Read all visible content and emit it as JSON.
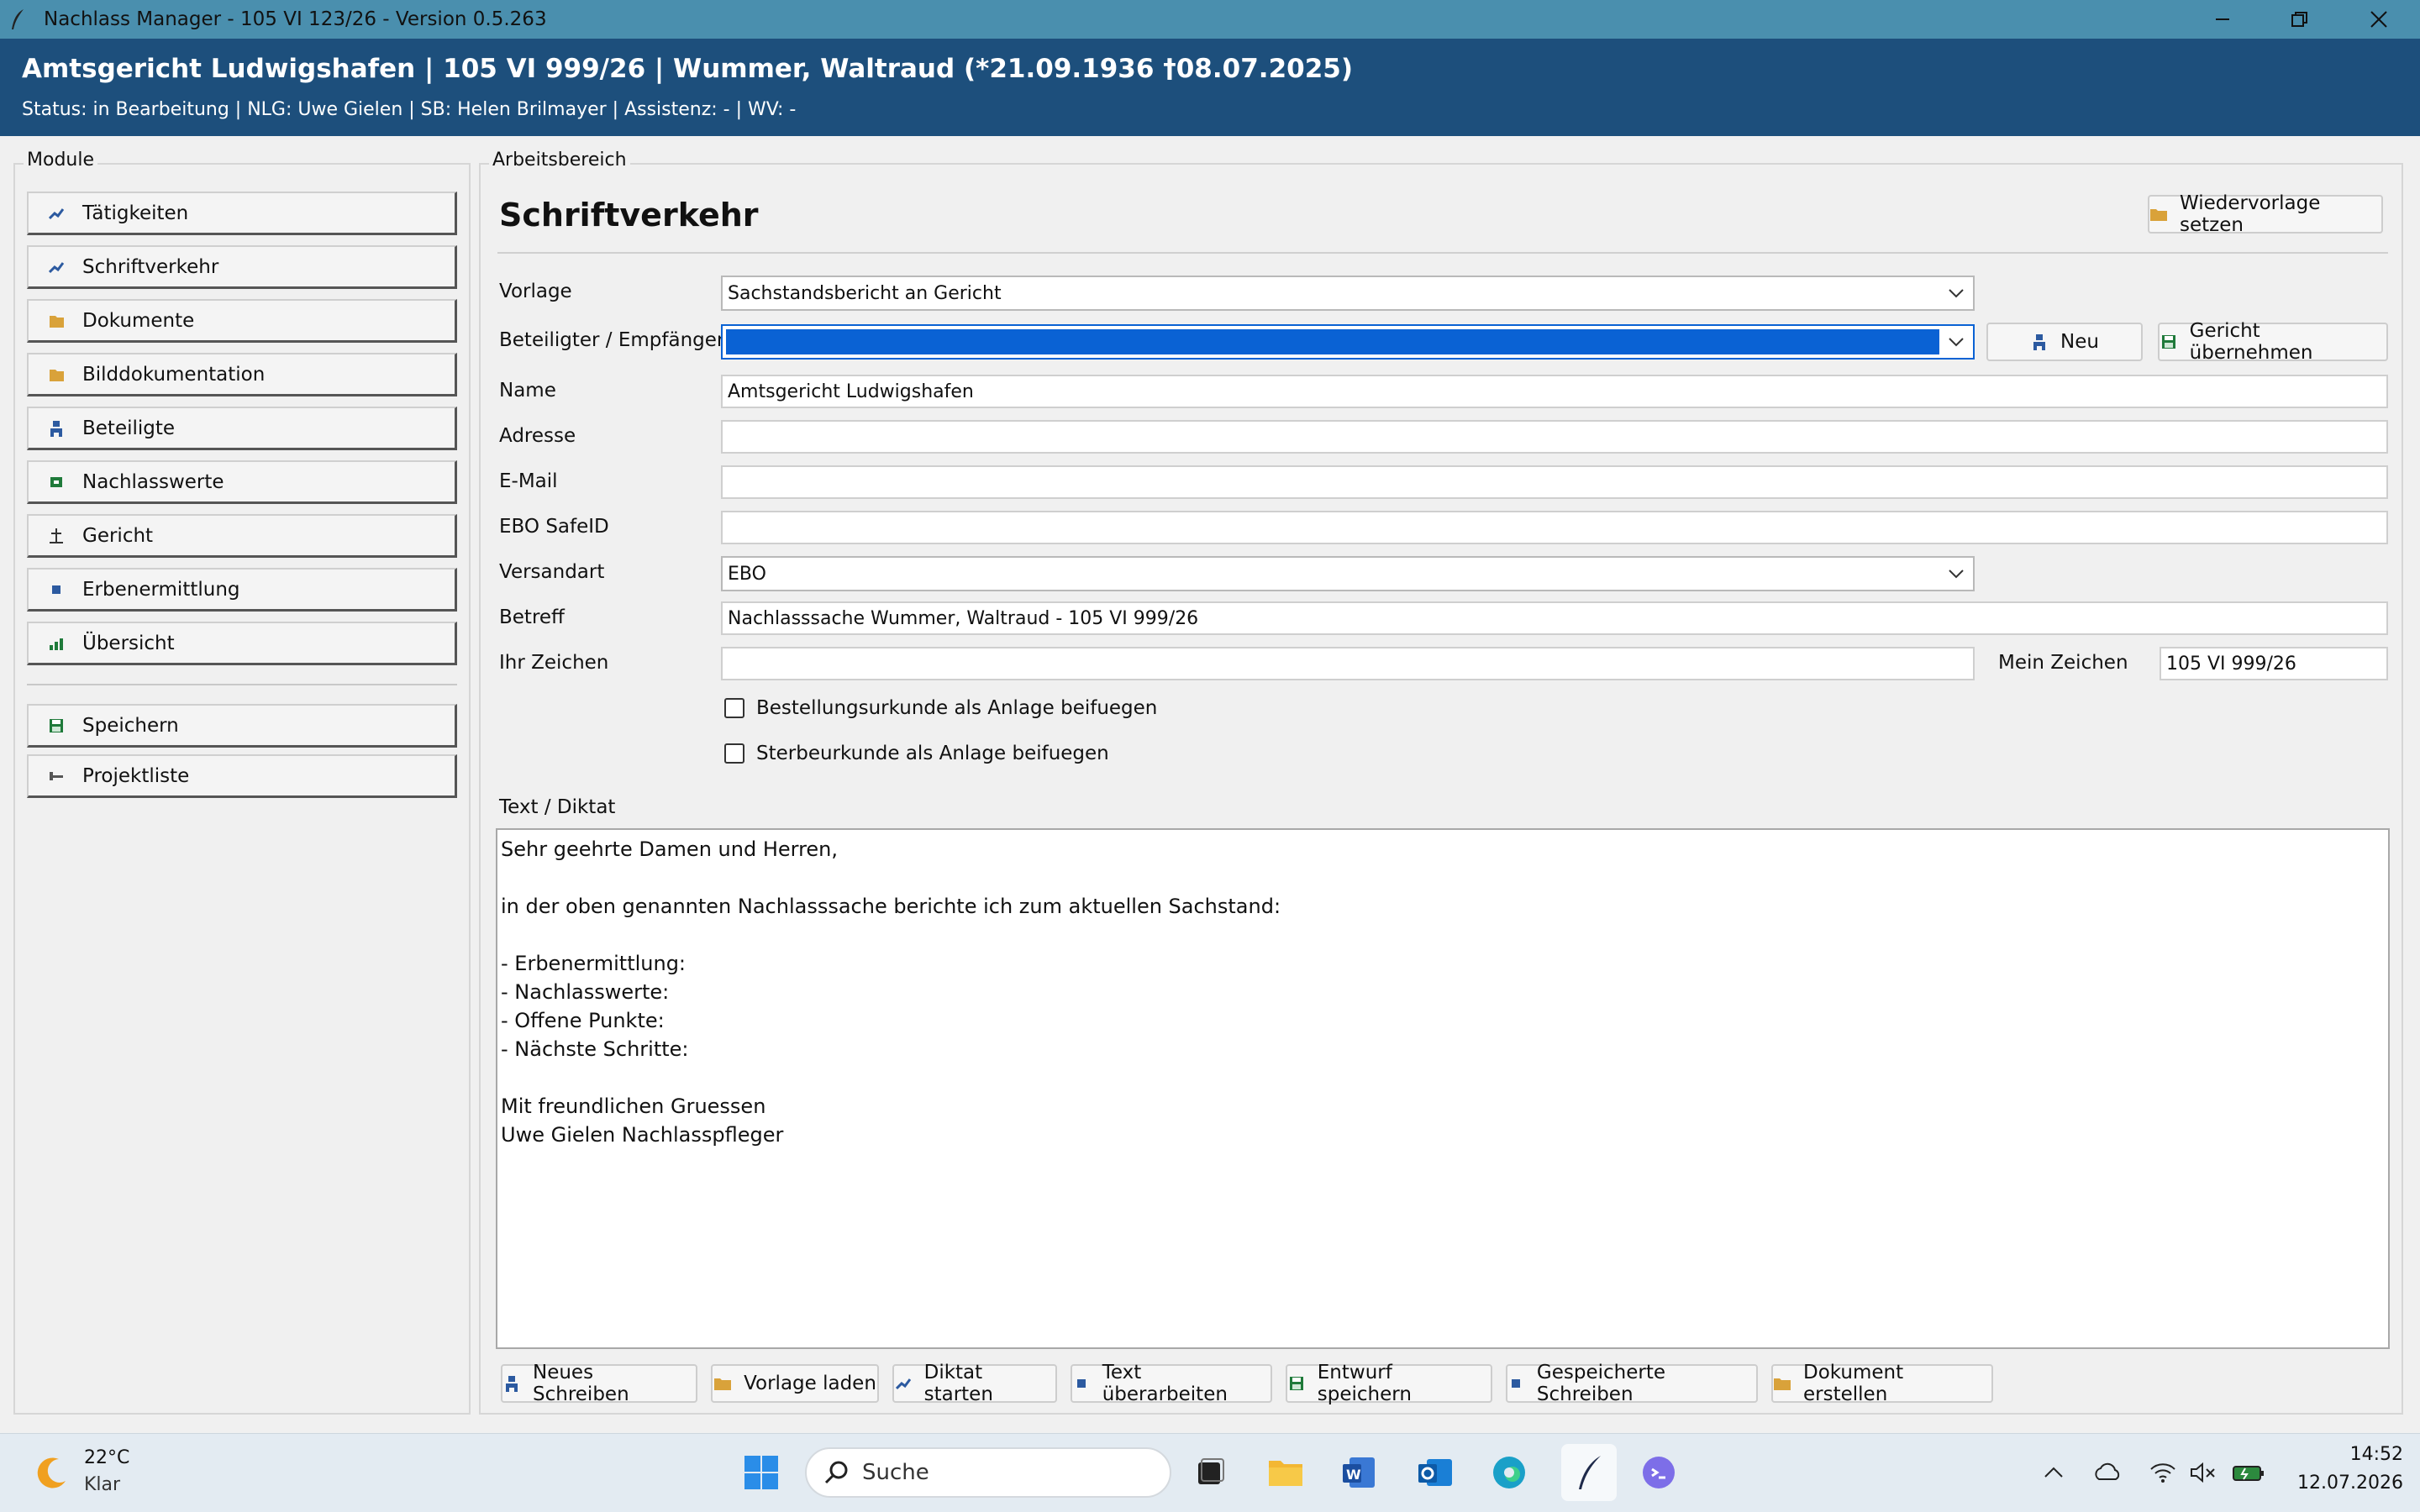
{
  "window": {
    "title": "Nachlass Manager - 105 VI 123/26 - Version 0.5.263"
  },
  "header": {
    "title": "Amtsgericht Ludwigshafen | 105 VI 999/26 | Wummer, Waltraud (*21.09.1936 †08.07.2025)",
    "status": "Status: in Bearbeitung | NLG: Uwe Gielen | SB: Helen Brilmayer | Assistenz: - | WV: -"
  },
  "sidebar": {
    "group_label": "Module",
    "items": [
      {
        "label": "Tätigkeiten",
        "icon": "chart-line-icon"
      },
      {
        "label": "Schriftverkehr",
        "icon": "chart-line-icon"
      },
      {
        "label": "Dokumente",
        "icon": "folder-icon"
      },
      {
        "label": "Bilddokumentation",
        "icon": "folder-icon"
      },
      {
        "label": "Beteiligte",
        "icon": "person-icon"
      },
      {
        "label": "Nachlasswerte",
        "icon": "money-icon"
      },
      {
        "label": "Gericht",
        "icon": "anchor-icon"
      },
      {
        "label": "Erbenermittlung",
        "icon": "square-icon"
      },
      {
        "label": "Übersicht",
        "icon": "bar-chart-icon"
      }
    ],
    "actions": [
      {
        "label": "Speichern",
        "icon": "save-icon"
      },
      {
        "label": "Projektliste",
        "icon": "list-icon"
      }
    ]
  },
  "workarea": {
    "group_label": "Arbeitsbereich",
    "title": "Schriftverkehr",
    "wiedervorlage_label": "Wiedervorlage setzen",
    "form": {
      "vorlage_label": "Vorlage",
      "vorlage_value": "Sachstandsbericht an Gericht",
      "empfaenger_label": "Beteiligter / Empfänger",
      "empfaenger_value": "",
      "neu_label": "Neu",
      "gericht_label": "Gericht übernehmen",
      "name_label": "Name",
      "name_value": "Amtsgericht Ludwigshafen",
      "adresse_label": "Adresse",
      "adresse_value": "",
      "email_label": "E-Mail",
      "email_value": "",
      "safeid_label": "EBO SafeID",
      "safeid_value": "",
      "versandart_label": "Versandart",
      "versandart_value": "EBO",
      "betreff_label": "Betreff",
      "betreff_value": "Nachlasssache Wummer, Waltraud - 105 VI 999/26",
      "ihr_zeichen_label": "Ihr Zeichen",
      "ihr_zeichen_value": "",
      "mein_zeichen_label": "Mein Zeichen",
      "mein_zeichen_value": "105 VI 999/26",
      "checkbox1_label": "Bestellungsurkunde als Anlage beifuegen",
      "checkbox1_checked": false,
      "checkbox2_label": "Sterbeurkunde als Anlage beifuegen",
      "checkbox2_checked": false
    },
    "text_label": "Text / Diktat",
    "text_lines": [
      "Sehr geehrte Damen und Herren,",
      "",
      "in der oben genannten Nachlasssache berichte ich zum aktuellen Sachstand:",
      "",
      "- Erbenermittlung:",
      "- Nachlasswerte:",
      "- Offene Punkte:",
      "- Nächste Schritte:",
      "",
      "Mit freundlichen Gruessen",
      "Uwe Gielen Nachlasspfleger"
    ],
    "bottom_buttons": [
      {
        "label": "Neues Schreiben",
        "icon": "person-icon"
      },
      {
        "label": "Vorlage laden",
        "icon": "folder-icon"
      },
      {
        "label": "Diktat starten",
        "icon": "chart-line-icon"
      },
      {
        "label": "Text überarbeiten",
        "icon": "square-icon"
      },
      {
        "label": "Entwurf speichern",
        "icon": "save-icon"
      },
      {
        "label": "Gespeicherte Schreiben",
        "icon": "square-icon"
      },
      {
        "label": "Dokument erstellen",
        "icon": "folder-icon"
      }
    ]
  },
  "taskbar": {
    "weather_temp": "22°C",
    "weather_desc": "Klar",
    "search_placeholder": "Suche",
    "time": "14:52",
    "date": "12.07.2026"
  },
  "colors": {
    "titlebar": "#4a8fae",
    "header": "#1d4f7c",
    "selection": "#0a62d4",
    "folder": "#d9a23a",
    "save_green": "#1f7a3a",
    "icon_blue": "#2c5aa0"
  }
}
